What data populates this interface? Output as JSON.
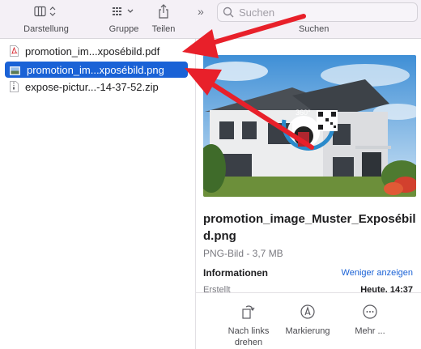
{
  "toolbar": {
    "view_label": "Darstellung",
    "group_label": "Gruppe",
    "share_label": "Teilen",
    "search_placeholder": "Suchen",
    "search_label": "Suchen"
  },
  "files": [
    {
      "name": "promotion_im...xposébild.pdf",
      "type": "pdf"
    },
    {
      "name": "promotion_im...xposébild.png",
      "type": "png",
      "selected": true
    },
    {
      "name": "expose-pictur...-14-37-52.zip",
      "type": "zip"
    }
  ],
  "preview": {
    "title": "promotion_image_Muster_Exposébild.png",
    "subtitle": "PNG-Bild - 3,7 MB",
    "info_heading": "Informationen",
    "show_less": "Weniger anzeigen",
    "row_label": "Erstellt",
    "row_value": "Heute, 14:37",
    "badge": "360°"
  },
  "actions": {
    "rotate_line1": "Nach links",
    "rotate_line2": "drehen",
    "markup": "Markierung",
    "more": "Mehr ..."
  },
  "colors": {
    "accent": "#1a62d6",
    "toolbar_bg": "#f4f0f6",
    "annotation_arrow": "#e8202a"
  }
}
